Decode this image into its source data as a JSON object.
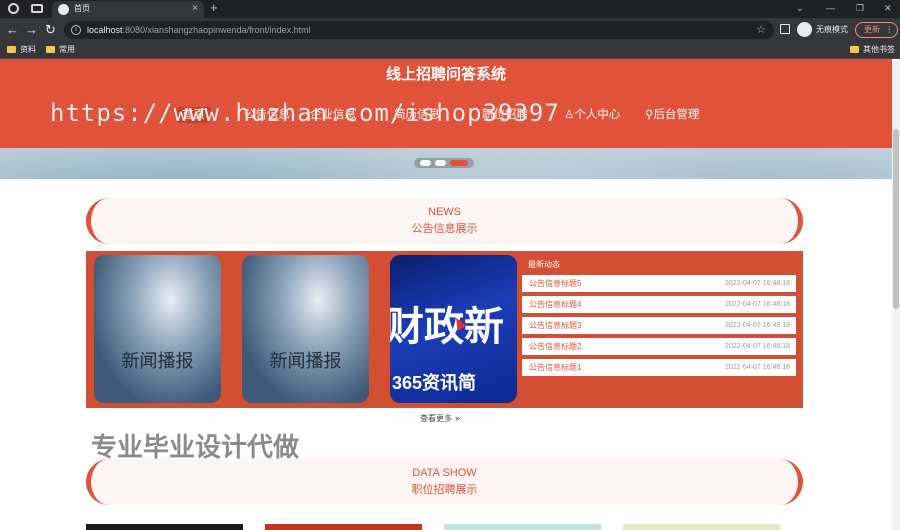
{
  "browser": {
    "tab_title": "首页",
    "tab_close": "×",
    "new_tab": "+",
    "url_host": "localhost",
    "url_rest": ":8080/xianshangzhaopinwenda/front/index.html",
    "incognito_label": "无痕模式",
    "update_label": "更新",
    "bookmarks": [
      "资料",
      "常用"
    ],
    "other_bookmarks": "其他书签"
  },
  "site": {
    "title": "线上招聘问答系统",
    "watermark": "https://www.huzhan.com/ishop39397"
  },
  "nav": {
    "items": [
      {
        "label": "首页"
      },
      {
        "label": "公告信息"
      },
      {
        "label": "企业信息"
      },
      {
        "label": "简历信息"
      },
      {
        "label": "职位招聘"
      },
      {
        "label": "个人中心"
      },
      {
        "label": "后台管理"
      }
    ]
  },
  "news_section": {
    "en": "NEWS",
    "cn": "公告信息展示",
    "card_caption": "新闻播报",
    "tv_big": "财政新",
    "tv_small": "365资讯简",
    "latest_title": "最新动态",
    "rows": [
      {
        "title": "公告信息标题5",
        "date": "2022-04-07 16:48:18"
      },
      {
        "title": "公告信息标题4",
        "date": "2022-04-07 16:48:18"
      },
      {
        "title": "公告信息标题3",
        "date": "2022-04-07 16:48:18"
      },
      {
        "title": "公告信息标题2",
        "date": "2022-04-07 16:48:18"
      },
      {
        "title": "公告信息标题1",
        "date": "2022-04-07 16:48:18"
      }
    ],
    "more": "查看更多"
  },
  "promo": "专业毕业设计代做",
  "data_section": {
    "en": "DATA SHOW",
    "cn": "职位招聘展示"
  },
  "colors": {
    "accent": "#e0533a",
    "panel": "#d24f33"
  }
}
